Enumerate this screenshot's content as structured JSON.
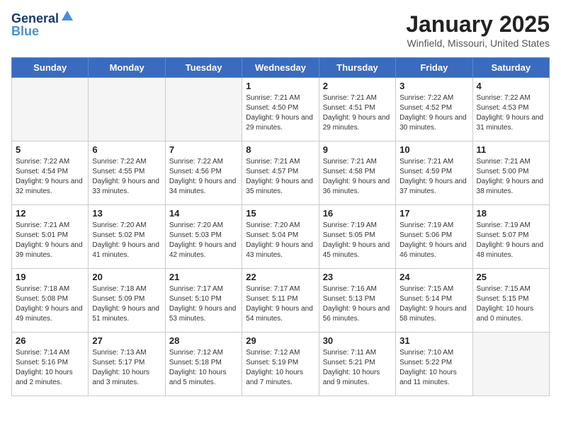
{
  "header": {
    "logo_line1": "General",
    "logo_line2": "Blue",
    "month": "January 2025",
    "location": "Winfield, Missouri, United States"
  },
  "days_of_week": [
    "Sunday",
    "Monday",
    "Tuesday",
    "Wednesday",
    "Thursday",
    "Friday",
    "Saturday"
  ],
  "weeks": [
    [
      {
        "day": "",
        "empty": true
      },
      {
        "day": "",
        "empty": true
      },
      {
        "day": "",
        "empty": true
      },
      {
        "day": "1",
        "sunrise": "7:21 AM",
        "sunset": "4:50 PM",
        "daylight": "9 hours and 29 minutes."
      },
      {
        "day": "2",
        "sunrise": "7:21 AM",
        "sunset": "4:51 PM",
        "daylight": "9 hours and 29 minutes."
      },
      {
        "day": "3",
        "sunrise": "7:22 AM",
        "sunset": "4:52 PM",
        "daylight": "9 hours and 30 minutes."
      },
      {
        "day": "4",
        "sunrise": "7:22 AM",
        "sunset": "4:53 PM",
        "daylight": "9 hours and 31 minutes."
      }
    ],
    [
      {
        "day": "5",
        "sunrise": "7:22 AM",
        "sunset": "4:54 PM",
        "daylight": "9 hours and 32 minutes."
      },
      {
        "day": "6",
        "sunrise": "7:22 AM",
        "sunset": "4:55 PM",
        "daylight": "9 hours and 33 minutes."
      },
      {
        "day": "7",
        "sunrise": "7:22 AM",
        "sunset": "4:56 PM",
        "daylight": "9 hours and 34 minutes."
      },
      {
        "day": "8",
        "sunrise": "7:21 AM",
        "sunset": "4:57 PM",
        "daylight": "9 hours and 35 minutes."
      },
      {
        "day": "9",
        "sunrise": "7:21 AM",
        "sunset": "4:58 PM",
        "daylight": "9 hours and 36 minutes."
      },
      {
        "day": "10",
        "sunrise": "7:21 AM",
        "sunset": "4:59 PM",
        "daylight": "9 hours and 37 minutes."
      },
      {
        "day": "11",
        "sunrise": "7:21 AM",
        "sunset": "5:00 PM",
        "daylight": "9 hours and 38 minutes."
      }
    ],
    [
      {
        "day": "12",
        "sunrise": "7:21 AM",
        "sunset": "5:01 PM",
        "daylight": "9 hours and 39 minutes."
      },
      {
        "day": "13",
        "sunrise": "7:20 AM",
        "sunset": "5:02 PM",
        "daylight": "9 hours and 41 minutes."
      },
      {
        "day": "14",
        "sunrise": "7:20 AM",
        "sunset": "5:03 PM",
        "daylight": "9 hours and 42 minutes."
      },
      {
        "day": "15",
        "sunrise": "7:20 AM",
        "sunset": "5:04 PM",
        "daylight": "9 hours and 43 minutes."
      },
      {
        "day": "16",
        "sunrise": "7:19 AM",
        "sunset": "5:05 PM",
        "daylight": "9 hours and 45 minutes."
      },
      {
        "day": "17",
        "sunrise": "7:19 AM",
        "sunset": "5:06 PM",
        "daylight": "9 hours and 46 minutes."
      },
      {
        "day": "18",
        "sunrise": "7:19 AM",
        "sunset": "5:07 PM",
        "daylight": "9 hours and 48 minutes."
      }
    ],
    [
      {
        "day": "19",
        "sunrise": "7:18 AM",
        "sunset": "5:08 PM",
        "daylight": "9 hours and 49 minutes."
      },
      {
        "day": "20",
        "sunrise": "7:18 AM",
        "sunset": "5:09 PM",
        "daylight": "9 hours and 51 minutes."
      },
      {
        "day": "21",
        "sunrise": "7:17 AM",
        "sunset": "5:10 PM",
        "daylight": "9 hours and 53 minutes."
      },
      {
        "day": "22",
        "sunrise": "7:17 AM",
        "sunset": "5:11 PM",
        "daylight": "9 hours and 54 minutes."
      },
      {
        "day": "23",
        "sunrise": "7:16 AM",
        "sunset": "5:13 PM",
        "daylight": "9 hours and 56 minutes."
      },
      {
        "day": "24",
        "sunrise": "7:15 AM",
        "sunset": "5:14 PM",
        "daylight": "9 hours and 58 minutes."
      },
      {
        "day": "25",
        "sunrise": "7:15 AM",
        "sunset": "5:15 PM",
        "daylight": "10 hours and 0 minutes."
      }
    ],
    [
      {
        "day": "26",
        "sunrise": "7:14 AM",
        "sunset": "5:16 PM",
        "daylight": "10 hours and 2 minutes."
      },
      {
        "day": "27",
        "sunrise": "7:13 AM",
        "sunset": "5:17 PM",
        "daylight": "10 hours and 3 minutes."
      },
      {
        "day": "28",
        "sunrise": "7:12 AM",
        "sunset": "5:18 PM",
        "daylight": "10 hours and 5 minutes."
      },
      {
        "day": "29",
        "sunrise": "7:12 AM",
        "sunset": "5:19 PM",
        "daylight": "10 hours and 7 minutes."
      },
      {
        "day": "30",
        "sunrise": "7:11 AM",
        "sunset": "5:21 PM",
        "daylight": "10 hours and 9 minutes."
      },
      {
        "day": "31",
        "sunrise": "7:10 AM",
        "sunset": "5:22 PM",
        "daylight": "10 hours and 11 minutes."
      },
      {
        "day": "",
        "empty": true
      }
    ]
  ]
}
